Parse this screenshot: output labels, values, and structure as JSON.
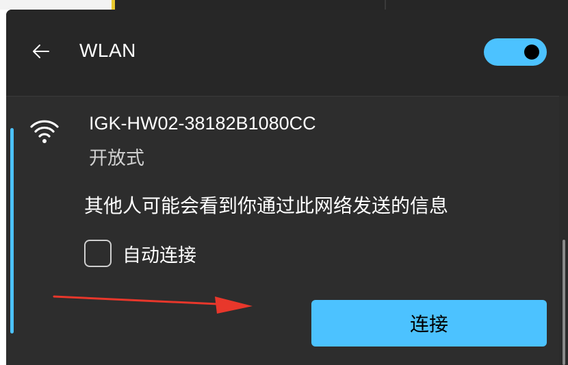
{
  "header": {
    "back_icon": "arrow-left-icon",
    "title": "WLAN",
    "toggle_state": "on"
  },
  "network": {
    "icon": "wifi-icon",
    "ssid": "IGK-HW02-38182B1080CC",
    "security": "开放式",
    "warning": "其他人可能会看到你通过此网络发送的信息",
    "auto_connect_label": "自动连接",
    "auto_connect_checked": false,
    "connect_label": "连接"
  },
  "colors": {
    "accent": "#4cc2ff",
    "panel_bg": "#2b2b2b",
    "annotation_arrow": "#e8372b"
  }
}
